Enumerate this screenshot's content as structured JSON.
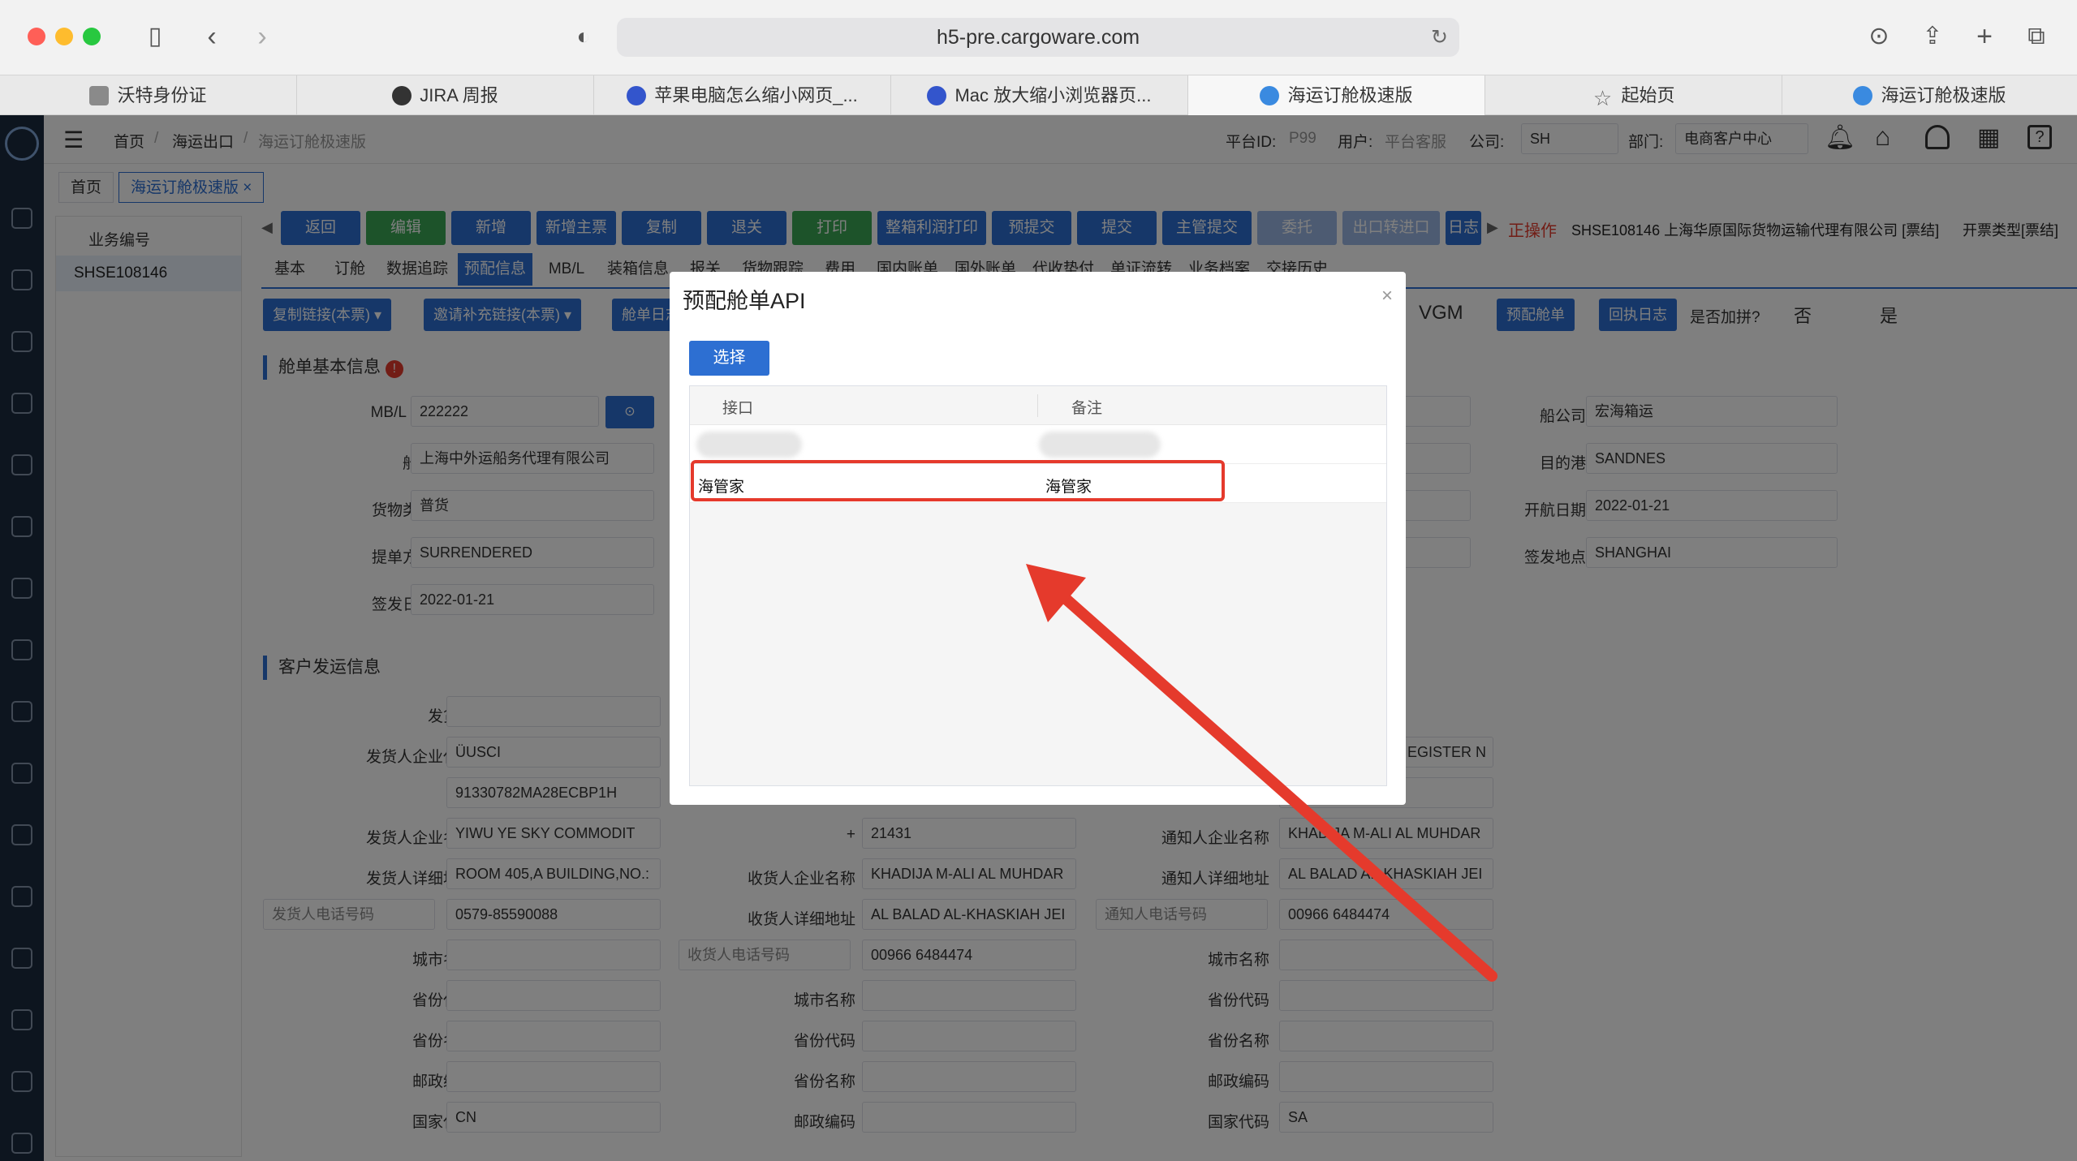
{
  "browser": {
    "url": "h5-pre.cargoware.com",
    "tabs": [
      {
        "label": "沃特身份证",
        "icon": "w-icon"
      },
      {
        "label": "JIRA 周报",
        "icon": "jira-icon"
      },
      {
        "label": "苹果电脑怎么缩小网页_...",
        "icon": "baidu-icon"
      },
      {
        "label": "Mac 放大缩小浏览器页...",
        "icon": "baidu-icon"
      },
      {
        "label": "海运订舱极速版",
        "icon": "globe-icon"
      },
      {
        "label": "起始页",
        "icon": "star-icon"
      },
      {
        "label": "海运订舱极速版",
        "icon": "globe-icon"
      }
    ]
  },
  "header": {
    "breadcrumb": [
      "首页",
      "海运出口",
      "海运订舱极速版"
    ],
    "platform_label": "平台ID:",
    "platform_value": "P99",
    "user_label": "用户:",
    "user_value": "平台客服",
    "company_label": "公司:",
    "company_value": "SH",
    "dept_label": "部门:",
    "dept_value": "电商客户中心"
  },
  "route_tabs": [
    "首页",
    "海运订舱极速版"
  ],
  "left_list": {
    "header": "业务编号",
    "items": [
      "SHSE108146"
    ]
  },
  "actions": [
    "返回",
    "编辑",
    "新增",
    "新增主票",
    "复制",
    "退关",
    "打印",
    "整箱利润打印",
    "预提交",
    "提交",
    "主管提交",
    "委托",
    "出口转进口",
    "日志"
  ],
  "action_colors": [
    "#2d6fd2",
    "#3aa655",
    "#2d6fd2",
    "#2d6fd2",
    "#2d6fd2",
    "#2d6fd2",
    "#3aa655",
    "#2d6fd2",
    "#2d6fd2",
    "#2d6fd2",
    "#2d6fd2",
    "#9bb6e4",
    "#9bb6e4",
    "#2d6fd2"
  ],
  "status": {
    "op": "正操作",
    "info": "SHSE108146 上海华原国际货物运输代理有限公司 [票结]",
    "invoice": "开票类型[票结]"
  },
  "detail_tabs": [
    "基本",
    "订舱",
    "数据追踪",
    "预配信息",
    "MB/L",
    "装箱信息",
    "报关",
    "货物跟踪",
    "费用",
    "国内账单",
    "国外账单",
    "代收垫付",
    "单证流转",
    "业务档案",
    "交接历史"
  ],
  "links": {
    "copy_link": "复制链接(本票)",
    "invite_link": "邀请补充链接(本票)",
    "log": "舱单日志",
    "vgm": "VGM",
    "prebook": "预配舱单",
    "receipt_log": "回执日志",
    "merge_q": "是否加拼?",
    "no": "否",
    "yes": "是"
  },
  "sections": {
    "basic": "舱单基本信息",
    "customer": "客户发运信息"
  },
  "basic_info": {
    "mbl_label": "MB/L NO",
    "mbl_value": "222222",
    "agent_label": "船代",
    "agent_value": "上海中外运船务代理有限公司",
    "cargo_label": "货物类型",
    "cargo_value": "普货",
    "bl_label": "提单方式",
    "bl_value": "SURRENDERED",
    "issue_label": "签发日期",
    "issue_value": "2022-01-21",
    "carrier_label": "船公司",
    "carrier_value": "宏海箱运",
    "dest_label": "目的港",
    "dest_value": "SANDNES",
    "sail_label": "开航日期",
    "sail_value": "2022-01-21",
    "place_label": "签发地点",
    "place_value": "SHANGHAI"
  },
  "shipper": {
    "rows": [
      {
        "label": "发货人",
        "value": ""
      },
      {
        "label": "发货人企业代码",
        "value": "ÜUSCI"
      },
      {
        "label": "+",
        "value": "91330782MA28ECBP1H"
      },
      {
        "label": "发货人企业名称",
        "value": "YIWU YE SKY COMMODIT"
      },
      {
        "label": "发货人详细地址",
        "value": "ROOM 405,A BUILDING,NO.:"
      },
      {
        "label": "发货人电话号码",
        "value": "0579-85590088"
      },
      {
        "label": "城市名称",
        "value": ""
      },
      {
        "label": "省份代码",
        "value": ""
      },
      {
        "label": "省份名称",
        "value": ""
      },
      {
        "label": "邮政编码",
        "value": ""
      },
      {
        "label": "国家代码",
        "value": "CN"
      }
    ]
  },
  "consignee": {
    "rows": [
      {
        "label": "+",
        "value": "21431"
      },
      {
        "label": "收货人企业名称",
        "value": "KHADIJA M-ALI AL MUHDAR"
      },
      {
        "label": "收货人详细地址",
        "value": "AL BALAD AL-KHASKIAH JEI"
      },
      {
        "label": "收货人电话号码",
        "value": "00966 6484474"
      },
      {
        "label": "城市名称",
        "value": ""
      },
      {
        "label": "省份代码",
        "value": ""
      },
      {
        "label": "省份名称",
        "value": ""
      },
      {
        "label": "邮政编码",
        "value": ""
      }
    ]
  },
  "notify": {
    "top_value": "EGISTER N",
    "rows": [
      {
        "label": "通知人企业名称",
        "value": "KHADIJA M-ALI AL MUHDAR"
      },
      {
        "label": "通知人详细地址",
        "value": "AL BALAD AL-KHASKIAH JEI"
      },
      {
        "label": "通知人电话号码",
        "value": "00966 6484474"
      },
      {
        "label": "城市名称",
        "value": ""
      },
      {
        "label": "省份代码",
        "value": ""
      },
      {
        "label": "省份名称",
        "value": ""
      },
      {
        "label": "邮政编码",
        "value": ""
      },
      {
        "label": "国家代码",
        "value": "SA"
      }
    ]
  },
  "dialog": {
    "title": "预配舱单API",
    "close": "×",
    "select_button": "选择",
    "columns": [
      "接口",
      "备注"
    ],
    "rows": [
      {
        "api": "海管家",
        "remark": "海管家"
      }
    ]
  },
  "annotation": {
    "color": "#e53a2c"
  }
}
